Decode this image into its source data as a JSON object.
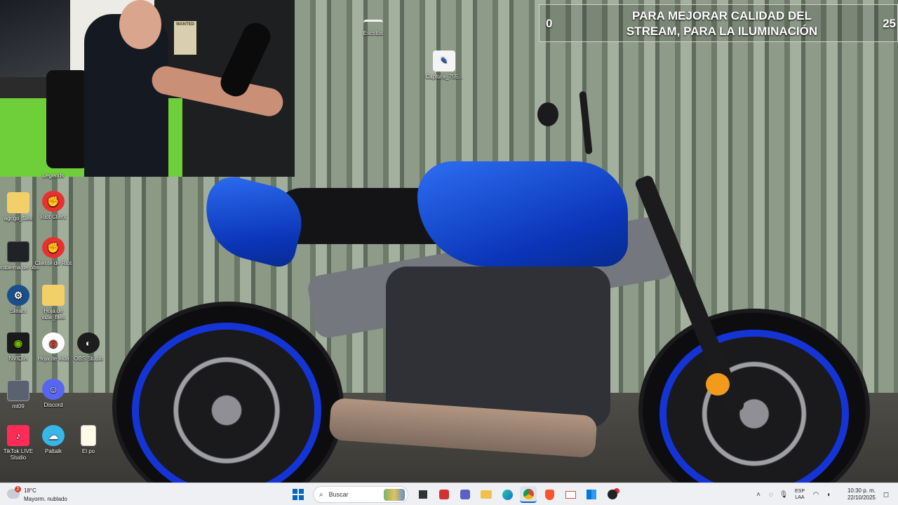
{
  "overlay": {
    "left_number": "0",
    "right_number": "25",
    "banner_line1": "PARA MEJORAR CALIDAD DEL",
    "banner_line2": "STREAM, PARA LA ILUMINACIÓN"
  },
  "webcam": {
    "poster_text": "WANTED"
  },
  "desktop_top_icons": [
    {
      "label": "Escritos"
    },
    {
      "label": "Captura_755..."
    }
  ],
  "desktop_icons": [
    {
      "label": "Legends"
    },
    {
      "label": "agcgo_files"
    },
    {
      "label": "Riot Client"
    },
    {
      "label": "problema de obs"
    },
    {
      "label": "Cliente de Riot"
    },
    {
      "label": "Steam"
    },
    {
      "label": "Hoja de vida_files"
    },
    {
      "label": "NVIDIA"
    },
    {
      "label": "Hoja de vida"
    },
    {
      "label": "OBS Studio"
    },
    {
      "label": "mt09"
    },
    {
      "label": "Discord"
    },
    {
      "label": "TikTok LIVE Studio"
    },
    {
      "label": "Paltalk"
    },
    {
      "label": "El po"
    }
  ],
  "taskbar": {
    "weather_temp": "18°C",
    "weather_desc": "Mayorm. nublado",
    "weather_badge": "2",
    "search_placeholder": "Buscar",
    "lang_line1": "ESP",
    "lang_line2": "LAA",
    "time": "10:30 p. m.",
    "date": "22/10/2025",
    "pinned_apps": [
      "task-view",
      "app-red",
      "teams",
      "file-explorer",
      "edge",
      "chrome",
      "brave",
      "mail",
      "store",
      "app-dark"
    ],
    "accent": "#0067c0"
  },
  "colors": {
    "moto_blue": "#1534d6",
    "banner_text": "#ffffff"
  }
}
